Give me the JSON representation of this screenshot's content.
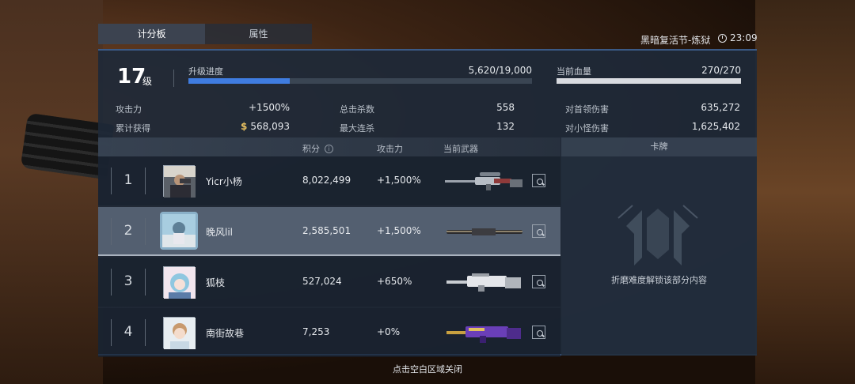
{
  "tabs": [
    {
      "label": "计分板",
      "active": true
    },
    {
      "label": "属性",
      "active": false
    }
  ],
  "header": {
    "event": "黑暗复活节-炼狱",
    "time": "23:09"
  },
  "player": {
    "level": "17",
    "level_unit": "级",
    "xp_label": "升级进度",
    "xp_value": "5,620/19,000",
    "xp_progress": 0.296,
    "hp_label": "当前血量",
    "hp_value": "270/270",
    "hp_progress": 1.0
  },
  "stats": {
    "attack_label": "攻击力",
    "attack_value": "+1500%",
    "earned_label": "累计获得",
    "earned_value": "568,093",
    "kills_label": "总击杀数",
    "kills_value": "558",
    "streak_label": "最大连杀",
    "streak_value": "132",
    "boss_dmg_label": "对首领伤害",
    "boss_dmg_value": "635,272",
    "minion_dmg_label": "对小怪伤害",
    "minion_dmg_value": "1,625,402"
  },
  "table": {
    "col_score": "积分",
    "col_attack": "攻击力",
    "col_weapon": "当前武器",
    "rows": [
      {
        "rank": "1",
        "name": "Yicr小杨",
        "score": "8,022,499",
        "attack": "+1,500%"
      },
      {
        "rank": "2",
        "name": "晚风lil",
        "score": "2,585,501",
        "attack": "+1,500%"
      },
      {
        "rank": "3",
        "name": "狐枝",
        "score": "527,024",
        "attack": "+650%"
      },
      {
        "rank": "4",
        "name": "南街故巷",
        "score": "7,253",
        "attack": "+0%"
      }
    ]
  },
  "cards": {
    "title": "卡牌",
    "locked_text": "折磨难度解锁该部分内容"
  },
  "footer": {
    "close_hint": "点击空白区域关闭"
  },
  "colors": {
    "xp_fill": "#3f7ce0",
    "hp_fill": "#d8dbe0",
    "panel_bg": "#1e2938",
    "highlight_row": "#566274"
  }
}
